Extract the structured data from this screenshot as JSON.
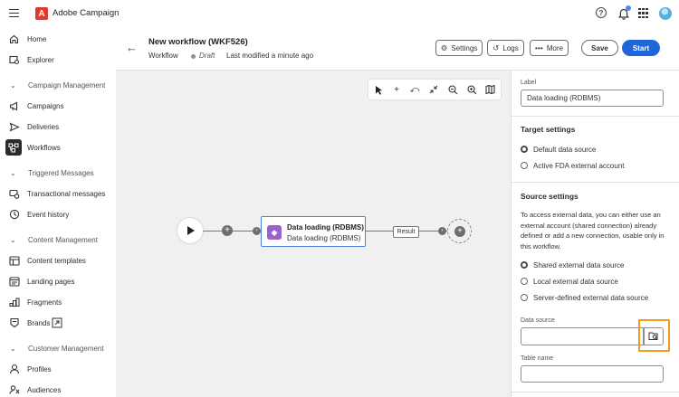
{
  "app": {
    "brand_name": "Adobe Campaign",
    "brand_logo_letter": "A"
  },
  "topbar": {
    "help_glyph": "?"
  },
  "sidebar": {
    "items": [
      {
        "label": "Home",
        "icon": "home-icon"
      },
      {
        "label": "Explorer",
        "icon": "explorer-icon"
      },
      {
        "label": "Campaign Management",
        "section": true
      },
      {
        "label": "Campaigns",
        "icon": "megaphone-icon"
      },
      {
        "label": "Deliveries",
        "icon": "send-icon"
      },
      {
        "label": "Workflows",
        "icon": "workflow-icon",
        "active": true
      },
      {
        "label": "Triggered Messages",
        "section": true
      },
      {
        "label": "Transactional messages",
        "icon": "transactional-icon"
      },
      {
        "label": "Event history",
        "icon": "history-icon"
      },
      {
        "label": "Content Management",
        "section": true
      },
      {
        "label": "Content templates",
        "icon": "template-icon"
      },
      {
        "label": "Landing pages",
        "icon": "landing-page-icon"
      },
      {
        "label": "Fragments",
        "icon": "fragments-icon"
      },
      {
        "label": "Brands",
        "icon": "brand-icon"
      },
      {
        "label": "Customer Management",
        "section": true
      },
      {
        "label": "Profiles",
        "icon": "profile-icon"
      },
      {
        "label": "Audiences",
        "icon": "audience-icon"
      }
    ]
  },
  "header": {
    "title": "New workflow (WKF526)",
    "type": "Workflow",
    "status": "Draft",
    "modified": "Last modified a minute ago",
    "settings_label": "Settings",
    "logs_label": "Logs",
    "more_label": "More",
    "save_label": "Save",
    "start_label": "Start"
  },
  "canvas": {
    "activity_title": "Data loading (RDBMS)",
    "activity_subtitle": "Data loading (RDBMS)",
    "result_label": "Result",
    "tools": [
      "select-icon",
      "add-icon",
      "rotate-icon",
      "collapse-icon",
      "zoom-out-icon",
      "zoom-in-icon",
      "minimap-icon"
    ]
  },
  "panel": {
    "label_caption": "Label",
    "label_value": "Data loading (RDBMS)",
    "target_title": "Target settings",
    "target_options": [
      "Default data source",
      "Active FDA external account"
    ],
    "source_title": "Source settings",
    "source_desc": "To access external data, you can either use an external account (shared connection) already defined or add a new connection, usable only in this workflow.",
    "source_options": [
      "Shared external data source",
      "Local external data source",
      "Server-defined external data source"
    ],
    "data_source_caption": "Data source",
    "table_name_caption": "Table name",
    "highlight_color": "#f29b1c",
    "accent_color": "#1f67d8"
  }
}
